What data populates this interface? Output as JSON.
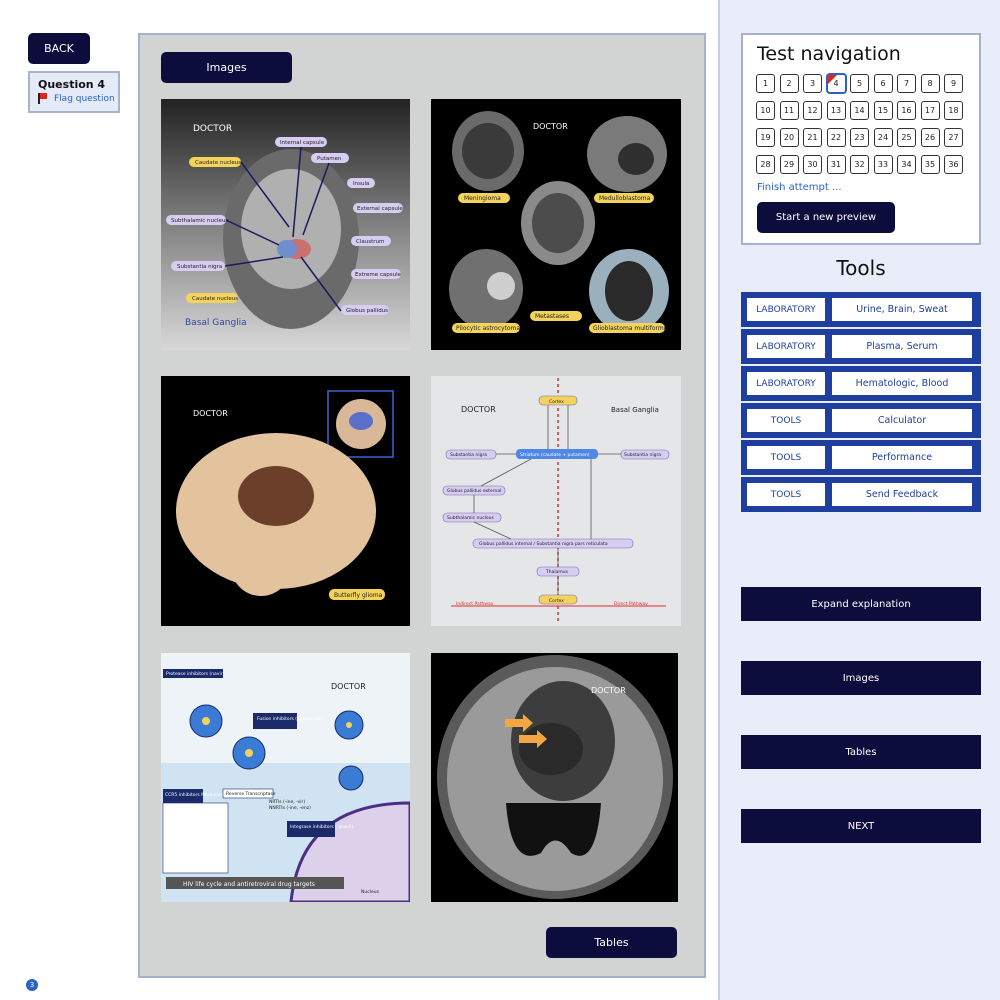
{
  "header": {
    "back_label": "BACK",
    "question_title": "Question 4",
    "flag_label": "Flag question",
    "page_badge": "3"
  },
  "main": {
    "images_tab_label": "Images",
    "tables_label": "Tables",
    "thumbnails": [
      {
        "brand": "DOCTOR",
        "caption": "Basal Ganglia",
        "labels": [
          "Caudate nucleus",
          "Internal capsule",
          "Putamen",
          "Insula",
          "External capsule",
          "Subthalamic nucleus",
          "Claustrum",
          "Substantia nigra",
          "Extreme capsule",
          "Caudate nucleus",
          "Globus pallidus"
        ]
      },
      {
        "brand": "DOCTOR",
        "labels": [
          "Meningioma",
          "Medulloblastoma",
          "Metastases",
          "Pilocytic astrocytoma",
          "Glioblastoma multiforme"
        ]
      },
      {
        "brand": "DOCTOR",
        "labels": [
          "Butterfly glioma"
        ]
      },
      {
        "brand": "DOCTOR",
        "title": "Basal Ganglia",
        "labels": [
          "Cortex",
          "Substantia nigra",
          "Striatum (caudate + putamen)",
          "Substantia nigra",
          "Globus pallidus external",
          "Subthalamic nucleus",
          "Globus pallidus internal / Substantia nigra pars reticulata",
          "Thalamus",
          "Cortex"
        ],
        "pathways": [
          "Indirect Pathway",
          "Direct Pathway"
        ]
      },
      {
        "brand": "DOCTOR",
        "header": "Protease inhibitors (navir)",
        "box_labels": [
          "Fusion inhibitors (Enfuvirtide)",
          "CCR5 inhibitors Maraviroc",
          "Reverse Transcriptase",
          "NRTIs (-ine, -vir)",
          "NNRTIs (-ine, -enz)",
          "Integrase inhibitors (-gravir)"
        ],
        "caption": "HIV life cycle and antiretroviral drug targets",
        "footer": "Nucleus"
      },
      {
        "brand": "DOCTOR"
      }
    ]
  },
  "nav": {
    "title": "Test navigation",
    "current": 4,
    "questions": [
      "1",
      "2",
      "3",
      "4",
      "5",
      "6",
      "7",
      "8",
      "9",
      "10",
      "11",
      "12",
      "13",
      "14",
      "15",
      "16",
      "17",
      "18",
      "19",
      "20",
      "21",
      "22",
      "23",
      "24",
      "25",
      "26",
      "27",
      "28",
      "29",
      "30",
      "31",
      "32",
      "33",
      "34",
      "35",
      "36"
    ],
    "finish_label": "Finish attempt ...",
    "preview_label": "Start a new preview"
  },
  "tools": {
    "title": "Tools",
    "items": [
      {
        "category": "LABORATORY",
        "name": "Urine, Brain, Sweat"
      },
      {
        "category": "LABORATORY",
        "name": "Plasma, Serum"
      },
      {
        "category": "LABORATORY",
        "name": "Hematologic, Blood"
      },
      {
        "category": "TOOLS",
        "name": "Calculator"
      },
      {
        "category": "TOOLS",
        "name": "Performance"
      },
      {
        "category": "TOOLS",
        "name": "Send Feedback"
      }
    ]
  },
  "actions": {
    "expand_label": "Expand explanation",
    "images_label": "Images",
    "tables_label": "Tables",
    "next_label": "NEXT"
  },
  "colors": {
    "navy": "#0d0d3d",
    "tool_blue": "#1e3fa0",
    "flag_red": "#e0251b",
    "link_blue": "#2a62c9",
    "sidebar_bg": "#e9ecf9",
    "panel_bg": "#d1d4d3"
  }
}
